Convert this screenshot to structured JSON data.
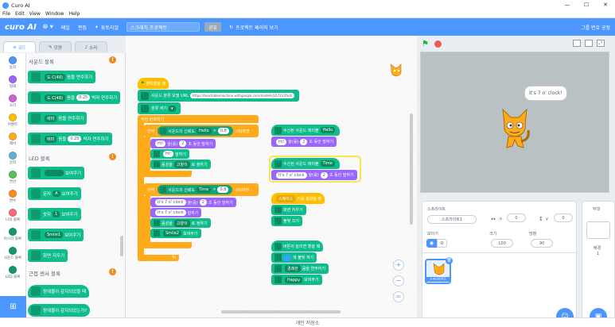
{
  "window": {
    "title": "Curo AI",
    "controls": [
      "—",
      "☐",
      "✕"
    ]
  },
  "menu": [
    "File",
    "Edit",
    "View",
    "Window",
    "Help"
  ],
  "appbar": {
    "brand": "curo AI",
    "items": [
      "페일",
      "편집",
      "튜토리얼"
    ],
    "project_title": "스크래치 프로젝트",
    "share": "공유",
    "see_project": "프로젝트 페이지 보기",
    "my_projects": "그룹 변호 공정"
  },
  "tabs": [
    "코드",
    "모양",
    "소리"
  ],
  "categories": [
    {
      "label": "동작",
      "color": "#4c97ff"
    },
    {
      "label": "형태",
      "color": "#9966ff"
    },
    {
      "label": "소리",
      "color": "#cf63cf"
    },
    {
      "label": "이벤트",
      "color": "#ffbf00"
    },
    {
      "label": "제어",
      "color": "#ffab19"
    },
    {
      "label": "감지",
      "color": "#5cb1d6"
    },
    {
      "label": "연산",
      "color": "#59c059"
    },
    {
      "label": "변수",
      "color": "#ff8c1a"
    },
    {
      "label": "나의 블록",
      "color": "#ff6680"
    },
    {
      "label": "마스터 블록",
      "color": "#0e9a6c"
    },
    {
      "label": "사운드 블록",
      "color": "#0e9a6c"
    },
    {
      "label": "LED 블록",
      "color": "#0e9a6c"
    }
  ],
  "palette": {
    "sound_header": "사운드 블록",
    "sound_blocks": [
      {
        "note": "도 C(48)",
        "text": "음을 연주하기"
      },
      {
        "note": "도 C(48)",
        "text": "음을",
        "beat": "0.25",
        "text2": "박자 연주하기"
      },
      {
        "note": "애미",
        "text": "음을 연주하기"
      },
      {
        "note": "애미",
        "text": "음을",
        "beat": "0.25",
        "text2": "박자 연주하기"
      }
    ],
    "led_header": "LED 블록",
    "led_blocks": [
      {
        "pre": "",
        "dd": "",
        "text": "보여주기"
      },
      {
        "pre": "문자",
        "dd": "A",
        "text": "보여주기"
      },
      {
        "pre": "숫자",
        "dd": "1",
        "text": "보여주기"
      },
      {
        "pre": "",
        "dd": "Smile1",
        "text": "보여주기"
      },
      {
        "pre": "",
        "dd": "",
        "text": "화면 지우기"
      }
    ],
    "sensor_header": "근접 센서 블록",
    "sensor_blocks": [
      "장애물이 감지되었을 때",
      "장애물이 감지되었는가?"
    ]
  },
  "script1": {
    "hat": "클릭했을 때",
    "url_label": "사운드 분류 모델 URL",
    "url": "https://teachablemachine.withgoogle.com/models/J2Lf1U3Yu0/",
    "start": "분류 켜기",
    "forever": "무한 반복하기",
    "if1": {
      "label": "만약",
      "cond": "사운드의 신뢰도",
      "dd": "Hello",
      "op": ">",
      "val": "0.8",
      "then": "(이)라면"
    },
    "if1_body": [
      {
        "pill": "Hi!",
        "mid": "을(를)",
        "num": "2",
        "text": "초 동안 말하기"
      },
      {
        "pill": "Hi!",
        "text": "말하기"
      },
      {
        "pre": "음성을",
        "dd": "고양이",
        "text": "로 정하기"
      }
    ],
    "if2": {
      "label": "만약",
      "cond": "사운드의 신뢰도",
      "dd": "Time",
      "op": ">",
      "val": "0.8",
      "then": "(이)라면"
    },
    "if2_body": [
      {
        "pill": "It's 7 o' clock",
        "mid": "을(를)",
        "num": "2",
        "text": "초 동안 말하기"
      },
      {
        "pill": "It's 7 o' clock",
        "text": "말하기"
      },
      {
        "pre": "음성을",
        "dd": "고양이",
        "text": "로 정하기"
      },
      {
        "dd": "Smile2",
        "text": "보여주기"
      }
    ]
  },
  "script2": {
    "hat": "수신된 사운드 레이블",
    "dd": "Hello",
    "body": {
      "pill": "Hi!",
      "mid": "을(를)",
      "num": "2",
      "text": "초 동안 말하기"
    }
  },
  "script3": {
    "hat": "수신된 사운드 레이블",
    "dd": "Time",
    "body": {
      "pill": "It's 7 o' clock",
      "mid": "을(를)",
      "num": "2",
      "text": "초 동안 말하기"
    }
  },
  "script4": {
    "hat_dd": "스페이스",
    "hat": "키를 눌렀을 때",
    "body": [
      "화면 지우기",
      "불빛 끄기"
    ]
  },
  "script5": {
    "hat": "버튼이 눌리면 했을 때",
    "body": [
      {
        "text": "색 불빛 켜기"
      },
      {
        "dd": "경쾌한",
        "text": "음을 연주하기"
      },
      {
        "dd": "Happy",
        "text": "보여주기"
      }
    ]
  },
  "stage": {
    "speech": "It's 7 o' clock!"
  },
  "sprite_info": {
    "sprite_label": "스프라이트",
    "sprite_name": "스프라이트1",
    "x_label": "x",
    "x": "0",
    "y_label": "y",
    "y": "0",
    "show_label": "보이기",
    "size_label": "크기",
    "size": "100",
    "dir_label": "방향",
    "direction": "90",
    "thumb_name": "스프라이트1"
  },
  "backdrop": {
    "label": "무대",
    "sub": "배경",
    "count": "1"
  },
  "bottom": {
    "save": "개인 저장소"
  }
}
